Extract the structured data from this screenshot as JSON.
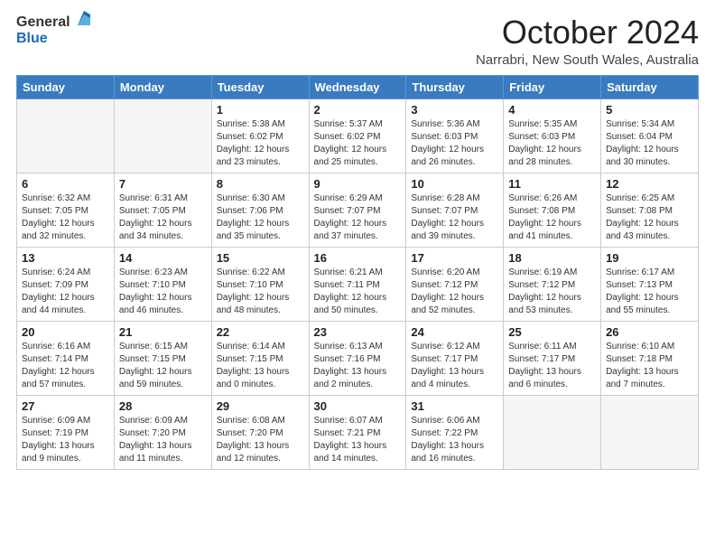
{
  "logo": {
    "general": "General",
    "blue": "Blue"
  },
  "title": "October 2024",
  "subtitle": "Narrabri, New South Wales, Australia",
  "days_of_week": [
    "Sunday",
    "Monday",
    "Tuesday",
    "Wednesday",
    "Thursday",
    "Friday",
    "Saturday"
  ],
  "weeks": [
    [
      {
        "day": "",
        "info": ""
      },
      {
        "day": "",
        "info": ""
      },
      {
        "day": "1",
        "info": "Sunrise: 5:38 AM\nSunset: 6:02 PM\nDaylight: 12 hours and 23 minutes."
      },
      {
        "day": "2",
        "info": "Sunrise: 5:37 AM\nSunset: 6:02 PM\nDaylight: 12 hours and 25 minutes."
      },
      {
        "day": "3",
        "info": "Sunrise: 5:36 AM\nSunset: 6:03 PM\nDaylight: 12 hours and 26 minutes."
      },
      {
        "day": "4",
        "info": "Sunrise: 5:35 AM\nSunset: 6:03 PM\nDaylight: 12 hours and 28 minutes."
      },
      {
        "day": "5",
        "info": "Sunrise: 5:34 AM\nSunset: 6:04 PM\nDaylight: 12 hours and 30 minutes."
      }
    ],
    [
      {
        "day": "6",
        "info": "Sunrise: 6:32 AM\nSunset: 7:05 PM\nDaylight: 12 hours and 32 minutes."
      },
      {
        "day": "7",
        "info": "Sunrise: 6:31 AM\nSunset: 7:05 PM\nDaylight: 12 hours and 34 minutes."
      },
      {
        "day": "8",
        "info": "Sunrise: 6:30 AM\nSunset: 7:06 PM\nDaylight: 12 hours and 35 minutes."
      },
      {
        "day": "9",
        "info": "Sunrise: 6:29 AM\nSunset: 7:07 PM\nDaylight: 12 hours and 37 minutes."
      },
      {
        "day": "10",
        "info": "Sunrise: 6:28 AM\nSunset: 7:07 PM\nDaylight: 12 hours and 39 minutes."
      },
      {
        "day": "11",
        "info": "Sunrise: 6:26 AM\nSunset: 7:08 PM\nDaylight: 12 hours and 41 minutes."
      },
      {
        "day": "12",
        "info": "Sunrise: 6:25 AM\nSunset: 7:08 PM\nDaylight: 12 hours and 43 minutes."
      }
    ],
    [
      {
        "day": "13",
        "info": "Sunrise: 6:24 AM\nSunset: 7:09 PM\nDaylight: 12 hours and 44 minutes."
      },
      {
        "day": "14",
        "info": "Sunrise: 6:23 AM\nSunset: 7:10 PM\nDaylight: 12 hours and 46 minutes."
      },
      {
        "day": "15",
        "info": "Sunrise: 6:22 AM\nSunset: 7:10 PM\nDaylight: 12 hours and 48 minutes."
      },
      {
        "day": "16",
        "info": "Sunrise: 6:21 AM\nSunset: 7:11 PM\nDaylight: 12 hours and 50 minutes."
      },
      {
        "day": "17",
        "info": "Sunrise: 6:20 AM\nSunset: 7:12 PM\nDaylight: 12 hours and 52 minutes."
      },
      {
        "day": "18",
        "info": "Sunrise: 6:19 AM\nSunset: 7:12 PM\nDaylight: 12 hours and 53 minutes."
      },
      {
        "day": "19",
        "info": "Sunrise: 6:17 AM\nSunset: 7:13 PM\nDaylight: 12 hours and 55 minutes."
      }
    ],
    [
      {
        "day": "20",
        "info": "Sunrise: 6:16 AM\nSunset: 7:14 PM\nDaylight: 12 hours and 57 minutes."
      },
      {
        "day": "21",
        "info": "Sunrise: 6:15 AM\nSunset: 7:15 PM\nDaylight: 12 hours and 59 minutes."
      },
      {
        "day": "22",
        "info": "Sunrise: 6:14 AM\nSunset: 7:15 PM\nDaylight: 13 hours and 0 minutes."
      },
      {
        "day": "23",
        "info": "Sunrise: 6:13 AM\nSunset: 7:16 PM\nDaylight: 13 hours and 2 minutes."
      },
      {
        "day": "24",
        "info": "Sunrise: 6:12 AM\nSunset: 7:17 PM\nDaylight: 13 hours and 4 minutes."
      },
      {
        "day": "25",
        "info": "Sunrise: 6:11 AM\nSunset: 7:17 PM\nDaylight: 13 hours and 6 minutes."
      },
      {
        "day": "26",
        "info": "Sunrise: 6:10 AM\nSunset: 7:18 PM\nDaylight: 13 hours and 7 minutes."
      }
    ],
    [
      {
        "day": "27",
        "info": "Sunrise: 6:09 AM\nSunset: 7:19 PM\nDaylight: 13 hours and 9 minutes."
      },
      {
        "day": "28",
        "info": "Sunrise: 6:09 AM\nSunset: 7:20 PM\nDaylight: 13 hours and 11 minutes."
      },
      {
        "day": "29",
        "info": "Sunrise: 6:08 AM\nSunset: 7:20 PM\nDaylight: 13 hours and 12 minutes."
      },
      {
        "day": "30",
        "info": "Sunrise: 6:07 AM\nSunset: 7:21 PM\nDaylight: 13 hours and 14 minutes."
      },
      {
        "day": "31",
        "info": "Sunrise: 6:06 AM\nSunset: 7:22 PM\nDaylight: 13 hours and 16 minutes."
      },
      {
        "day": "",
        "info": ""
      },
      {
        "day": "",
        "info": ""
      }
    ]
  ]
}
